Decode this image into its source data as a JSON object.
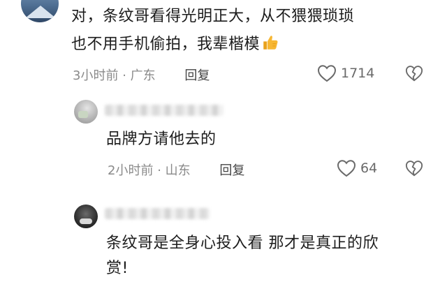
{
  "main_comment": {
    "line1": "对，条纹哥看得光明正大，从不猥猥琐琐",
    "line2": "也不用手机偷拍，我辈楷模",
    "thumb_emoji": "thumbs-up-icon",
    "time": "3小时前",
    "separator": "·",
    "location": "广东",
    "reply_label": "回复",
    "like_count": "1714"
  },
  "replies": [
    {
      "text": "品牌方请他去的",
      "time": "2小时前",
      "separator": "·",
      "location": "山东",
      "reply_label": "回复",
      "like_count": "64"
    },
    {
      "line1": "条纹哥是全身心投入看 那才是真正的欣",
      "line2": "赏!"
    }
  ],
  "colors": {
    "text": "#1c1c1c",
    "meta": "#8a8a8a",
    "icon": "#6a6a6a",
    "thumb": "#f7b733"
  }
}
